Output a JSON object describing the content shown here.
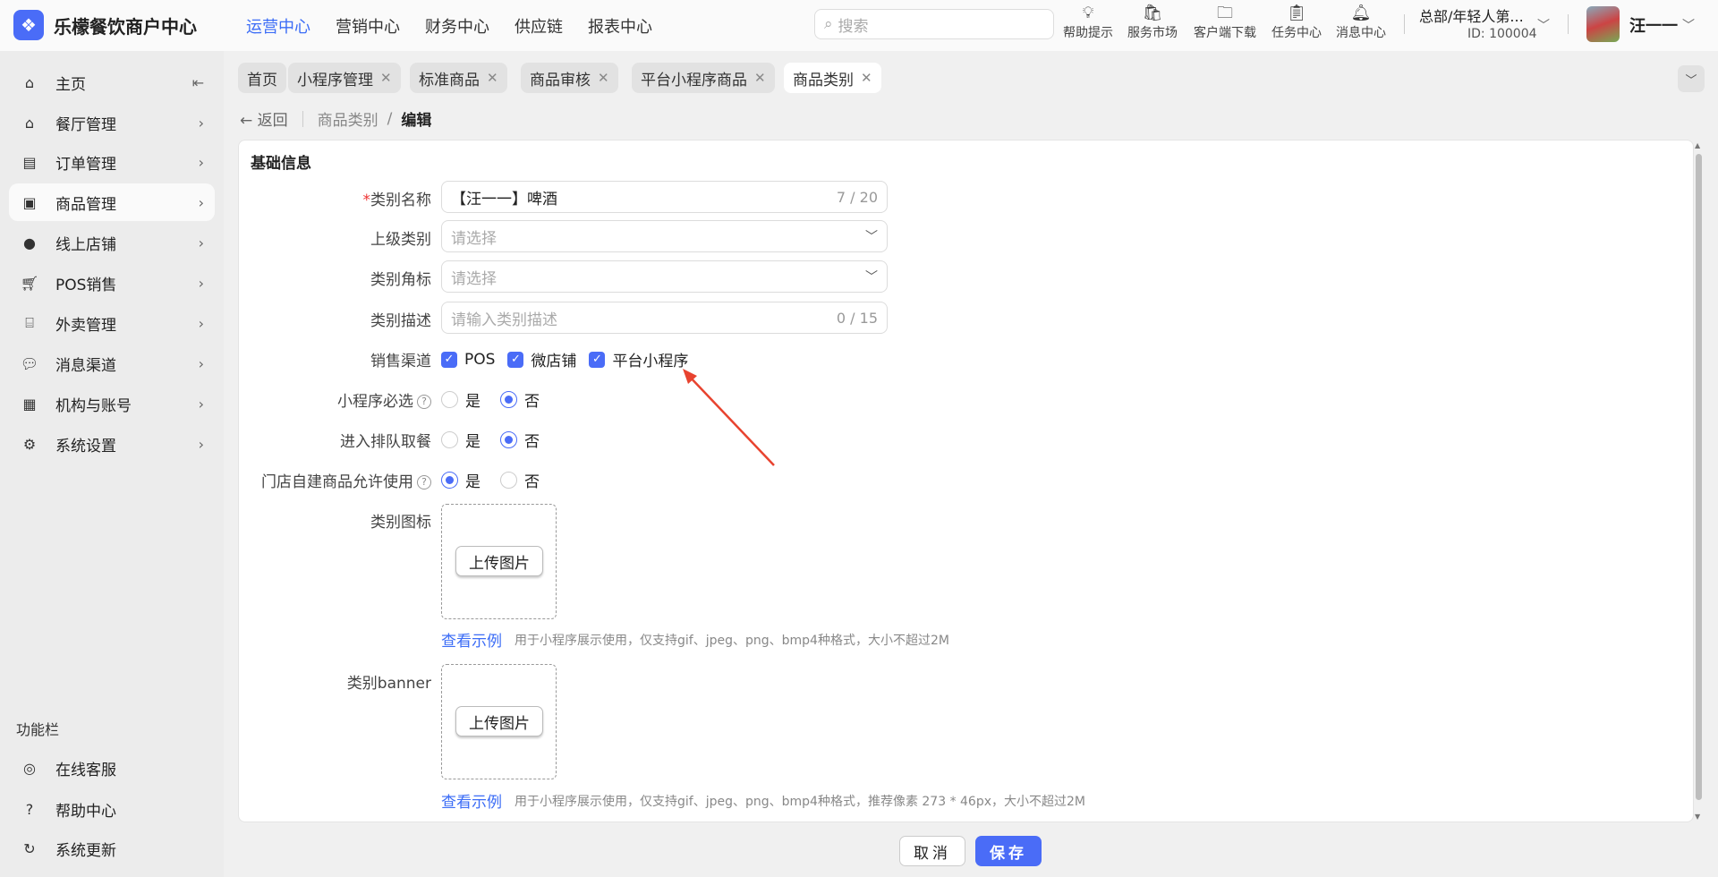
{
  "header": {
    "app_title": "乐檬餐饮商户中心",
    "nav": [
      "运营中心",
      "营销中心",
      "财务中心",
      "供应链",
      "报表中心"
    ],
    "search_placeholder": "搜索",
    "tools": [
      "帮助提示",
      "服务市场",
      "客户端下载",
      "任务中心",
      "消息中心"
    ],
    "org": "总部/年轻人第...",
    "org_id": "ID: 100004",
    "user": "汪一一"
  },
  "sidebar": {
    "items": [
      "主页",
      "餐厅管理",
      "订单管理",
      "商品管理",
      "线上店铺",
      "POS销售",
      "外卖管理",
      "消息渠道",
      "机构与账号",
      "系统设置"
    ],
    "section": "功能栏",
    "bottom": [
      "在线客服",
      "帮助中心",
      "系统更新"
    ]
  },
  "tabs": [
    "首页",
    "小程序管理",
    "标准商品",
    "商品审核",
    "平台小程序商品",
    "商品类别"
  ],
  "breadcrumb": {
    "back": "返回",
    "parent": "商品类别",
    "sep": "/",
    "current": "编辑"
  },
  "form": {
    "section_title": "基础信息",
    "name": {
      "label": "类别名称",
      "value": "【汪一一】啤酒",
      "count": "7 / 20"
    },
    "parent": {
      "label": "上级类别",
      "placeholder": "请选择"
    },
    "badge": {
      "label": "类别角标",
      "placeholder": "请选择"
    },
    "desc": {
      "label": "类别描述",
      "placeholder": "请输入类别描述",
      "count": "0 / 15"
    },
    "channels": {
      "label": "销售渠道",
      "options": [
        "POS",
        "微店铺",
        "平台小程序"
      ]
    },
    "mini_required": {
      "label": "小程序必选",
      "yes": "是",
      "no": "否",
      "selected": "否"
    },
    "queue": {
      "label": "进入排队取餐",
      "yes": "是",
      "no": "否",
      "selected": "否"
    },
    "store_allow": {
      "label": "门店自建商品允许使用",
      "yes": "是",
      "no": "否",
      "selected": "是"
    },
    "icon": {
      "label": "类别图标",
      "upload": "上传图片",
      "example": "查看示例",
      "hint": "用于小程序展示使用，仅支持gif、jpeg、png、bmp4种格式，大小不超过2M"
    },
    "banner": {
      "label": "类别banner",
      "upload": "上传图片",
      "example": "查看示例",
      "hint": "用于小程序展示使用，仅支持gif、jpeg、png、bmp4种格式，推荐像素 273 * 46px，大小不超过2M"
    }
  },
  "footer": {
    "cancel": "取消",
    "save": "保存"
  },
  "colors": {
    "accent": "#4a6cf7",
    "annotation_arrow": "#e8432f"
  }
}
